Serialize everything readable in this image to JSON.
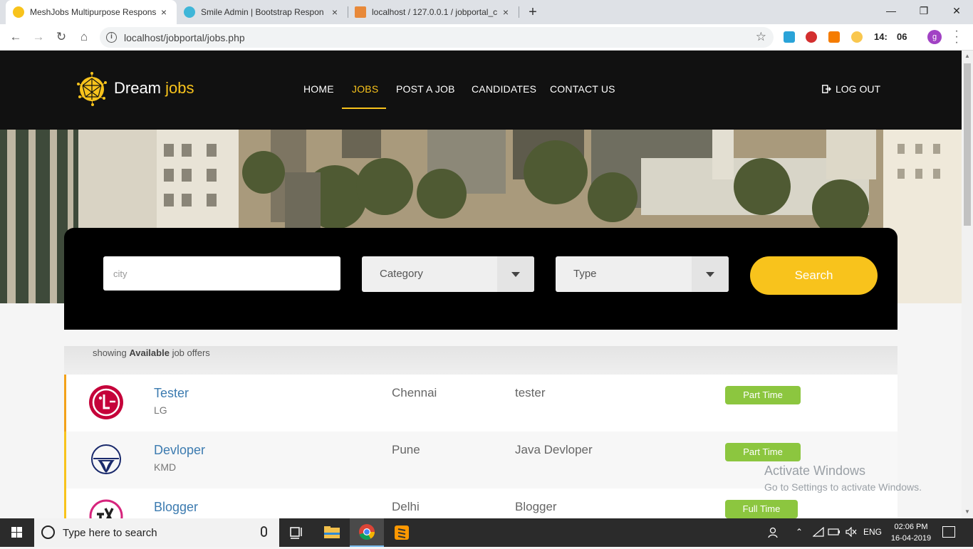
{
  "browser": {
    "tabs": [
      {
        "title": "MeshJobs Multipurpose Respons",
        "close": "×"
      },
      {
        "title": "Smile Admin | Bootstrap Respon",
        "close": "×"
      },
      {
        "title": "localhost / 127.0.0.1 / jobportal_c",
        "close": "×"
      }
    ],
    "new_tab": "+",
    "window": {
      "minimize": "—",
      "maximize": "❐",
      "close": "✕"
    },
    "nav": {
      "back": "←",
      "forward": "→",
      "reload": "↻",
      "home": "⌂"
    },
    "url": "localhost/jobportal/jobs.php",
    "bookmark": "☆",
    "ext_clock": [
      "14:",
      "06"
    ],
    "profile_initial": "g"
  },
  "site": {
    "logo_word1": "Dream",
    "logo_word2": "jobs",
    "nav": [
      "HOME",
      "JOBS",
      "POST A JOB",
      "CANDIDATES",
      "CONTACT US"
    ],
    "active_nav": "JOBS",
    "logout": "LOG OUT"
  },
  "search": {
    "city_placeholder": "city",
    "category": "Category",
    "type": "Type",
    "button": "Search"
  },
  "listing": {
    "showing_prefix": "showing",
    "showing_bold": "Available",
    "showing_suffix": "job offers",
    "jobs": [
      {
        "title": "Tester",
        "company": "LG",
        "location": "Chennai",
        "role": "tester",
        "type": "Part Time"
      },
      {
        "title": "Devloper",
        "company": "KMD",
        "location": "Pune",
        "role": "Java Devloper",
        "type": "Part Time"
      },
      {
        "title": "Blogger",
        "company": "",
        "location": "Delhi",
        "role": "Blogger",
        "type": "Full Time"
      }
    ]
  },
  "watermark": {
    "line1": "Activate Windows",
    "line2": "Go to Settings to activate Windows."
  },
  "taskbar": {
    "search_placeholder": "Type here to search",
    "lang": "ENG",
    "time": "02:06 PM",
    "date": "16-04-2019"
  },
  "colors": {
    "accent": "#f8c31c",
    "header_bg": "#111111",
    "badge_green": "#8cc63f",
    "title_blue": "#3c7bb0"
  }
}
